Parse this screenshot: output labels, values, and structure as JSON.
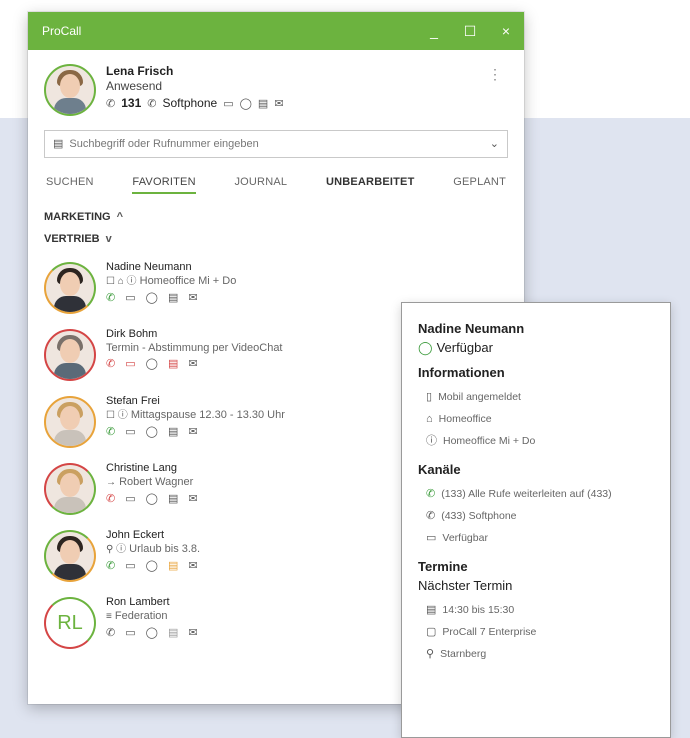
{
  "window": {
    "title": "ProCall",
    "minimize": "_",
    "maximize": "☐",
    "close": "×"
  },
  "profile": {
    "name": "Lena Frisch",
    "status": "Anwesend",
    "extension": "131",
    "softphone_label": "Softphone"
  },
  "search": {
    "placeholder": "Suchbegriff oder Rufnummer eingeben"
  },
  "tabs": [
    "SUCHEN",
    "FAVORITEN",
    "JOURNAL",
    "UNBEARBEITET",
    "GEPLANT"
  ],
  "groups": [
    {
      "label": "MARKETING",
      "chevron": "^"
    },
    {
      "label": "VERTRIEB",
      "chevron": "v"
    }
  ],
  "contacts": [
    {
      "name": "Nadine Neumann",
      "detail": "Homeoffice Mi + Do",
      "detail_icons": "☐ ⌂ ⓘ"
    },
    {
      "name": "Dirk Bohm",
      "detail": "Termin - Abstimmung per VideoChat",
      "detail_icons": ""
    },
    {
      "name": "Stefan Frei",
      "detail": "Mittagspause 12.30 - 13.30 Uhr",
      "detail_icons": "☐ ⓘ"
    },
    {
      "name": "Christine Lang",
      "detail": "Robert Wagner",
      "detail_icons": "→"
    },
    {
      "name": "John Eckert",
      "detail": "Urlaub bis 3.8.",
      "detail_icons": "⚲ ⓘ"
    },
    {
      "name": "Ron Lambert",
      "detail": "Federation",
      "detail_icons": "≡",
      "initials": "RL"
    }
  ],
  "popup": {
    "name": "Nadine Neumann",
    "availability": "Verfügbar",
    "info_title": "Informationen",
    "info": [
      "Mobil angemeldet",
      "Homeoffice",
      "Homeoffice Mi + Do"
    ],
    "channels_title": "Kanäle",
    "channels": [
      "(133) Alle Rufe weiterleiten auf (433)",
      "(433) Softphone",
      "Verfügbar"
    ],
    "appointments_title": "Termine",
    "next_appointment_label": "Nächster Termin",
    "appointment": [
      "14:30 bis 15:30",
      "ProCall 7 Enterprise",
      "Starnberg"
    ]
  }
}
